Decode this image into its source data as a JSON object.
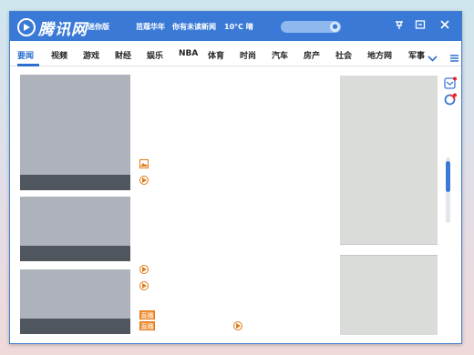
{
  "app": {
    "logo_text": "腾讯网",
    "edition": "迷你版",
    "headlines": [
      "茁蔻华年",
      "你有未读新闻"
    ],
    "weather": "10°C 晴"
  },
  "nav": {
    "items": [
      "要闻",
      "视频",
      "游戏",
      "财经",
      "娱乐",
      "NBA",
      "体育",
      "时尚",
      "汽车",
      "房产",
      "社会",
      "地方网",
      "军事"
    ],
    "active_index": 0
  },
  "tags": {
    "live": "直播"
  },
  "colors": {
    "brand_blue": "#3a7ad6",
    "accent_orange": "#e07a1a",
    "thumb_gray": "#aeb3bb",
    "caption_dark": "#50565e",
    "ad_gray": "#dadcd9"
  },
  "icons": [
    "logo-icon",
    "search-icon",
    "pin-icon",
    "window-icon",
    "close-icon",
    "chevron-down-icon",
    "menu-icon",
    "photo-icon",
    "video-icon",
    "mail-icon",
    "qq-icon"
  ]
}
